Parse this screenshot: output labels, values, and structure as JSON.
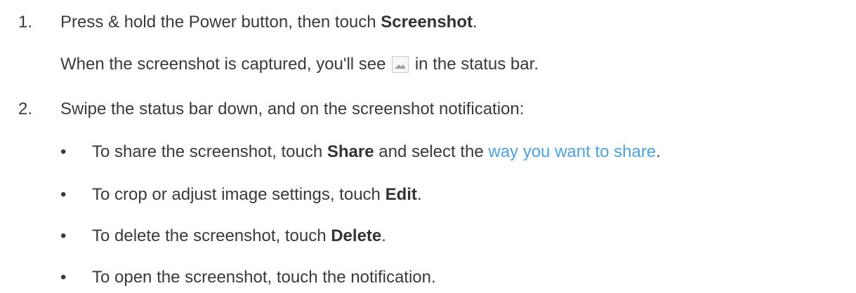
{
  "steps": [
    {
      "number": "1.",
      "line": {
        "pre": "Press & hold the Power button, then touch ",
        "bold": "Screenshot",
        "post": "."
      },
      "note": {
        "pre": "When the screenshot is captured, you'll see ",
        "icon": "screenshot-thumbnail-icon",
        "post": " in the status bar."
      }
    },
    {
      "number": "2.",
      "line": "Swipe the status bar down, and on the screenshot notification:",
      "bullets": [
        {
          "pre": "To share the screenshot, touch ",
          "bold": "Share",
          "mid": " and select the ",
          "link": "way you want to share",
          "post": "."
        },
        {
          "pre": "To crop or adjust image settings, touch ",
          "bold": "Edit",
          "post": "."
        },
        {
          "pre": "To delete the screenshot, touch ",
          "bold": "Delete",
          "post": "."
        },
        {
          "pre": "To open the screenshot, touch the notification."
        }
      ]
    }
  ],
  "bullet_glyph": "•",
  "colors": {
    "text": "#3a3a3a",
    "link": "#4aa3e8"
  }
}
